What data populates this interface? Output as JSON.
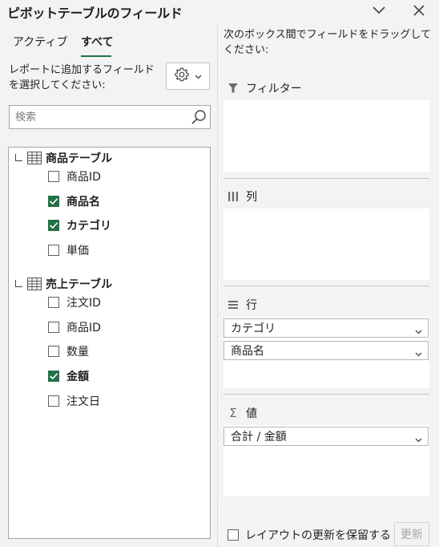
{
  "header": {
    "title": "ピボットテーブルのフィールド",
    "dropdown_icon": "chevron-down-icon",
    "close_icon": "close-icon"
  },
  "tabs": [
    {
      "label": "アクティブ",
      "active": false
    },
    {
      "label": "すべて",
      "active": true
    }
  ],
  "instruction": "レポートに追加するフィールドを選択してください:",
  "gear": {
    "icon": "gear-icon",
    "caret": "chevron-down-icon"
  },
  "search": {
    "placeholder": "検索",
    "icon": "search-icon"
  },
  "tables": [
    {
      "name": "商品テーブル",
      "fields": [
        {
          "label": "商品ID",
          "checked": false
        },
        {
          "label": "商品名",
          "checked": true
        },
        {
          "label": "カテゴリ",
          "checked": true
        },
        {
          "label": "単価",
          "checked": false
        }
      ]
    },
    {
      "name": "売上テーブル",
      "fields": [
        {
          "label": "注文ID",
          "checked": false
        },
        {
          "label": "商品ID",
          "checked": false
        },
        {
          "label": "数量",
          "checked": false
        },
        {
          "label": "金額",
          "checked": true
        },
        {
          "label": "注文日",
          "checked": false
        }
      ]
    }
  ],
  "drag_instruction": "次のボックス間でフィールドをドラッグしてください:",
  "areas": {
    "filters": {
      "label": "フィルター",
      "icon": "filter-icon",
      "items": []
    },
    "columns": {
      "label": "列",
      "icon": "columns-icon",
      "items": []
    },
    "rows": {
      "label": "行",
      "icon": "rows-icon",
      "items": [
        "カテゴリ",
        "商品名"
      ]
    },
    "values": {
      "label": "値",
      "icon": "sigma-icon",
      "items": [
        "合計 / 金額"
      ]
    }
  },
  "footer": {
    "defer_label": "レイアウトの更新を保留する",
    "defer_checked": false,
    "update_label": "更新"
  },
  "colors": {
    "accent": "#217346",
    "background": "#f3f3f3"
  }
}
